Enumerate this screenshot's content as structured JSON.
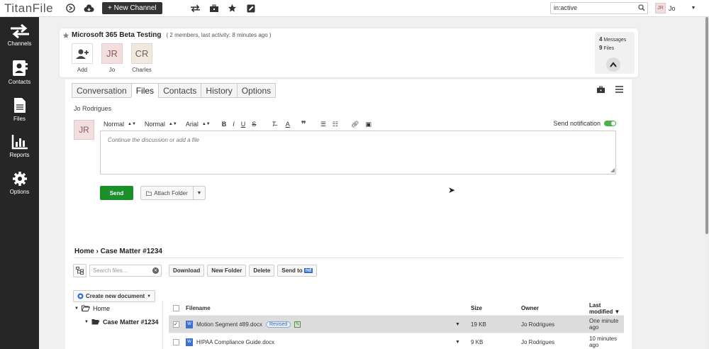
{
  "app": {
    "logo": "TitanFile"
  },
  "topbar": {
    "new_channel_label": "+ New Channel",
    "search_value": "in:active",
    "user_initials": "JR",
    "user_name": "Jo"
  },
  "sidebar": {
    "items": [
      {
        "label": "Channels",
        "icon": "channels-icon"
      },
      {
        "label": "Contacts",
        "icon": "contacts-icon"
      },
      {
        "label": "Files",
        "icon": "files-icon"
      },
      {
        "label": "Reports",
        "icon": "reports-icon"
      },
      {
        "label": "Options",
        "icon": "gear-icon"
      }
    ]
  },
  "channel": {
    "title": "Microsoft 365 Beta Testing",
    "meta": "( 2 members, last activity: 8 minutes ago )",
    "members": [
      {
        "initials": "",
        "label": "Add"
      },
      {
        "initials": "JR",
        "label": "Jo"
      },
      {
        "initials": "CR",
        "label": "Charles"
      }
    ],
    "stats": {
      "messages_count": "4",
      "messages_label": "Messages",
      "files_count": "9",
      "files_label": "Files"
    }
  },
  "tabs": [
    "Conversation",
    "Files",
    "Contacts",
    "History",
    "Options"
  ],
  "composer": {
    "author": "Jo Rodrigues",
    "author_initials": "JR",
    "format1": "Normal",
    "format2": "Normal",
    "font": "Arial",
    "send_notification_label": "Send notification",
    "placeholder": "Continue the discussion or add a file",
    "send_label": "Send",
    "attach_label": "Attach Folder"
  },
  "files": {
    "breadcrumb": "Home › Case Matter #1234",
    "search_placeholder": "Search files...",
    "buttons": {
      "download": "Download",
      "new_folder": "New Folder",
      "delete": "Delete",
      "send_to": "Send to",
      "send_to_badge": "nd"
    },
    "create_doc_label": "Create new document",
    "tree": {
      "root": "Home",
      "child": "Case Matter #1234"
    },
    "columns": {
      "filename": "Filename",
      "size": "Size",
      "owner": "Owner",
      "modified": "Last modified ▼"
    },
    "rows": [
      {
        "name": "Motion Segment #89.docx",
        "badge": "Revised",
        "size": "19 KB",
        "owner": "Jo Rodrigues",
        "modified": "One minute ago",
        "selected": true
      },
      {
        "name": "HIPAA Compliance Guide.docx",
        "badge": "",
        "size": "9 KB",
        "owner": "Jo Rodrigues",
        "modified": "10 minutes ago",
        "selected": false
      }
    ]
  }
}
